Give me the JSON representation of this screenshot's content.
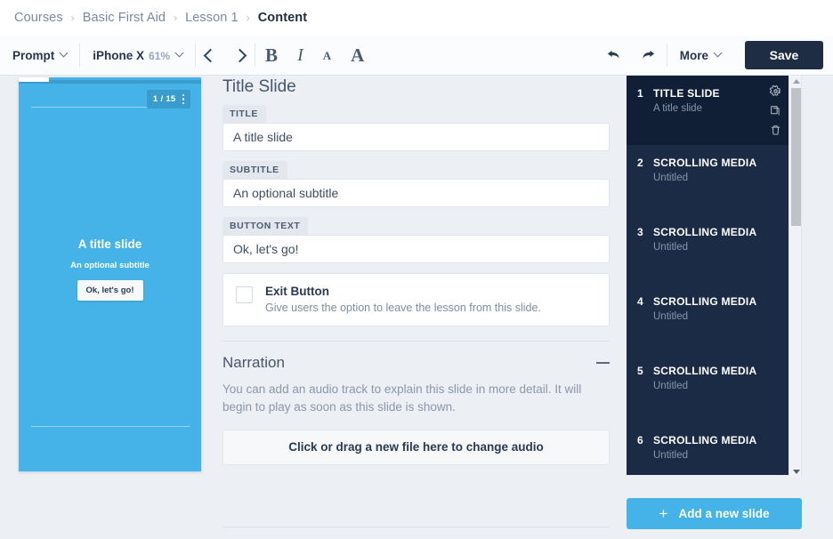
{
  "breadcrumb": {
    "separator": "›",
    "items": [
      {
        "label": "Courses",
        "active": false
      },
      {
        "label": "Basic First Aid",
        "active": false
      },
      {
        "label": "Lesson 1",
        "active": false
      },
      {
        "label": "Content",
        "active": true
      }
    ]
  },
  "toolbar": {
    "prompt_label": "Prompt",
    "device_label": "iPhone X",
    "zoom_level": "61%",
    "prev_icon": "chevron-left-icon",
    "next_icon": "chevron-right-icon",
    "bold_label": "B",
    "italic_label": "I",
    "font_small_label": "A",
    "font_large_label": "A",
    "undo_icon": "undo-arrow-icon",
    "redo_icon": "redo-arrow-icon",
    "more_label": "More",
    "save_label": "Save",
    "save_bg": "#1e2d43"
  },
  "preview": {
    "device_frame": "iphone-x-frame",
    "slide_bg": "#45b3e7",
    "badge_text": "1 / 15",
    "badge_menu_icon": "kebab-menu-icon",
    "title": "A title slide",
    "subtitle": "An optional subtitle",
    "button_text": "Ok, let's go!"
  },
  "form": {
    "page_title": "Title Slide",
    "fields": [
      {
        "label": "TITLE",
        "value": "A title slide"
      },
      {
        "label": "SUBTITLE",
        "value": "An optional subtitle"
      },
      {
        "label": "BUTTON TEXT",
        "value": "Ok, let's go!"
      }
    ],
    "exit_button": {
      "title": "Exit Button",
      "description": "Give users the option to leave the lesson from this slide.",
      "checked": false
    },
    "narration": {
      "title": "Narration",
      "collapse_icon": "minus-icon",
      "description": "You can add an audio track to explain this slide in more detail. It will begin to play as soon as this slide is shown.",
      "dropzone_label": "Click or drag a new file here to change audio"
    }
  },
  "slides_panel": {
    "accent_color": "#45b3e7",
    "panel_bg": "#1c2b45",
    "active_bg": "#111f36",
    "items": [
      {
        "number": "1",
        "type": "TITLE SLIDE",
        "name": "A title slide",
        "active": true
      },
      {
        "number": "2",
        "type": "SCROLLING MEDIA",
        "name": "Untitled",
        "active": false
      },
      {
        "number": "3",
        "type": "SCROLLING MEDIA",
        "name": "Untitled",
        "active": false
      },
      {
        "number": "4",
        "type": "SCROLLING MEDIA",
        "name": "Untitled",
        "active": false
      },
      {
        "number": "5",
        "type": "SCROLLING MEDIA",
        "name": "Untitled",
        "active": false
      },
      {
        "number": "6",
        "type": "SCROLLING MEDIA",
        "name": "Untitled",
        "active": false
      }
    ],
    "actions": {
      "settings_icon": "gear-icon",
      "duplicate_icon": "copy-icon",
      "delete_icon": "trash-icon"
    },
    "add_slide_label": "Add a new slide",
    "add_slide_plus": "+"
  }
}
